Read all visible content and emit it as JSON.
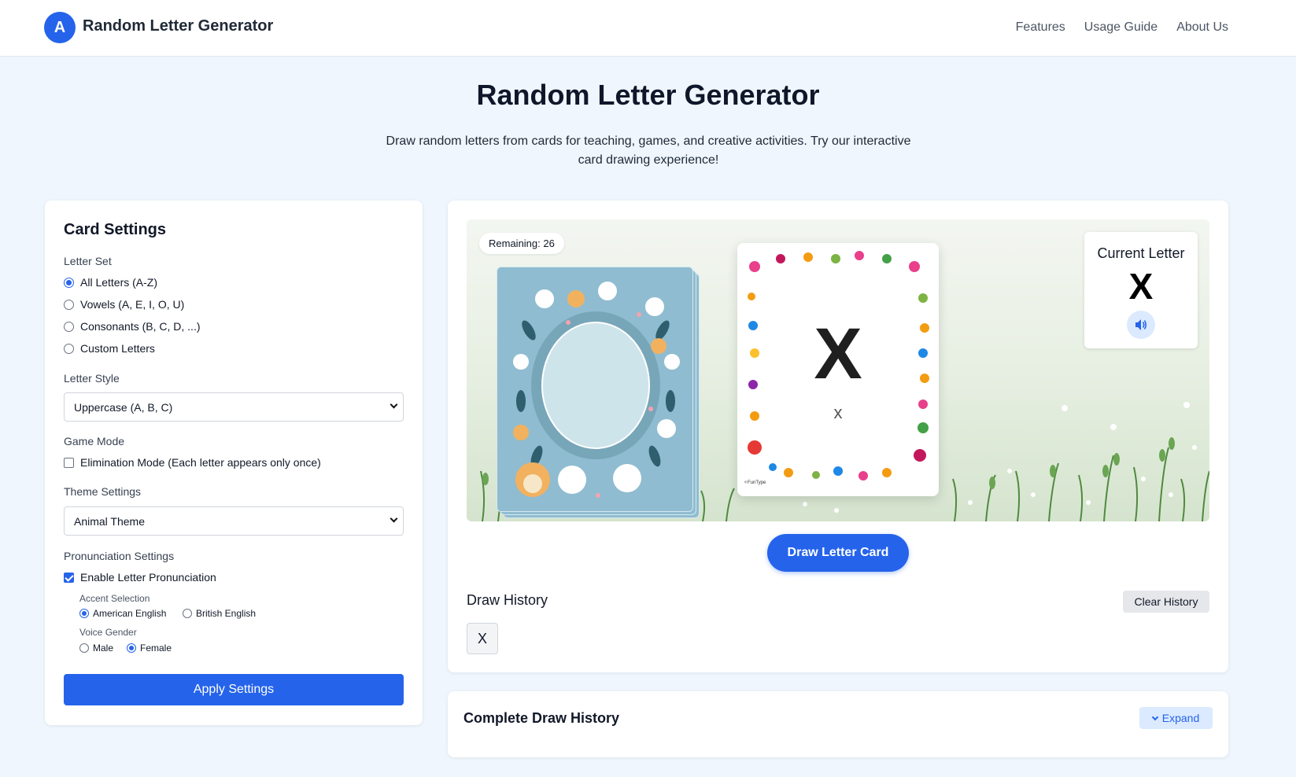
{
  "header": {
    "logo_letter": "A",
    "brand": "Random Letter Generator",
    "nav": [
      "Features",
      "Usage Guide",
      "About Us"
    ]
  },
  "hero": {
    "title": "Random Letter Generator",
    "subtitle": "Draw random letters from cards for teaching, games, and creative activities. Try our interactive card drawing experience!"
  },
  "settings": {
    "title": "Card Settings",
    "letter_set_label": "Letter Set",
    "letter_set_options": [
      "All Letters (A-Z)",
      "Vowels (A, E, I, O, U)",
      "Consonants (B, C, D, ...)",
      "Custom Letters"
    ],
    "letter_set_selected": 0,
    "letter_style_label": "Letter Style",
    "letter_style_value": "Uppercase (A, B, C)",
    "game_mode_label": "Game Mode",
    "elimination_label": "Elimination Mode (Each letter appears only once)",
    "elimination_checked": false,
    "theme_label": "Theme Settings",
    "theme_value": "Animal Theme",
    "pronunciation_label": "Pronunciation Settings",
    "enable_pron_label": "Enable Letter Pronunciation",
    "enable_pron_checked": true,
    "accent_label": "Accent Selection",
    "accent_options": [
      "American English",
      "British English"
    ],
    "accent_selected": 0,
    "gender_label": "Voice Gender",
    "gender_options": [
      "Male",
      "Female"
    ],
    "gender_selected": 1,
    "apply_label": "Apply Settings"
  },
  "game": {
    "remaining": "Remaining: 26",
    "card_letter": "X",
    "card_lower": "x",
    "card_brand": "✧FunType",
    "current_title": "Current Letter",
    "current_letter": "X",
    "draw_label": "Draw Letter Card",
    "history_title": "Draw History",
    "clear_label": "Clear History",
    "history_items": [
      "X"
    ]
  },
  "complete": {
    "title": "Complete Draw History",
    "expand_label": "Expand"
  },
  "colors": {
    "accent": "#2563eb",
    "page_bg": "#eff6fd",
    "deck_blue": "#8fbcd0"
  }
}
